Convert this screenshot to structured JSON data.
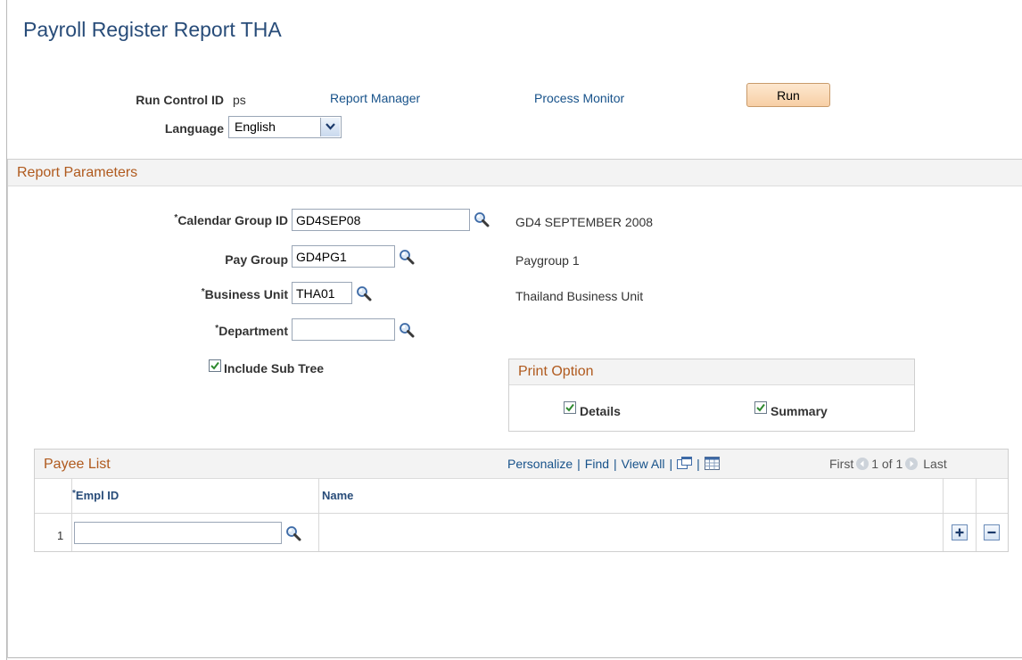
{
  "page": {
    "title": "Payroll Register Report THA"
  },
  "run_control": {
    "label": "Run Control ID",
    "value": "ps",
    "report_manager": "Report Manager",
    "process_monitor": "Process Monitor",
    "run_label": "Run",
    "language_label": "Language",
    "language_value": "English"
  },
  "report_parameters": {
    "title": "Report Parameters",
    "calendar_group": {
      "label": "Calendar Group ID",
      "value": "GD4SEP08",
      "description": "GD4 SEPTEMBER 2008"
    },
    "pay_group": {
      "label": "Pay Group",
      "value": "GD4PG1",
      "description": "Paygroup 1"
    },
    "business_unit": {
      "label": "Business Unit",
      "value": "THA01",
      "description": "Thailand Business Unit"
    },
    "department": {
      "label": "Department",
      "value": ""
    },
    "include_sub_tree": {
      "label": "Include Sub Tree",
      "checked": true
    }
  },
  "print_option": {
    "title": "Print Option",
    "details": {
      "label": "Details",
      "checked": true
    },
    "summary": {
      "label": "Summary",
      "checked": true
    }
  },
  "payee_list": {
    "title": "Payee List",
    "toolbar": {
      "personalize": "Personalize",
      "find": "Find",
      "view_all": "View All",
      "sep": "|"
    },
    "nav": {
      "first": "First",
      "position": "1 of 1",
      "last": "Last"
    },
    "columns": {
      "empl_id": "Empl ID",
      "name": "Name"
    },
    "rows": [
      {
        "num": "1",
        "empl_id": "",
        "name": ""
      }
    ]
  },
  "colors": {
    "title": "#284c79",
    "link": "#17528a",
    "section_title": "#b05a1e"
  },
  "icons": [
    "lookup-icon",
    "dropdown-arrow-icon",
    "checkmark-icon",
    "new-window-icon",
    "download-grid-icon",
    "previous-arrow-icon",
    "next-arrow-icon",
    "add-row-icon",
    "delete-row-icon"
  ]
}
